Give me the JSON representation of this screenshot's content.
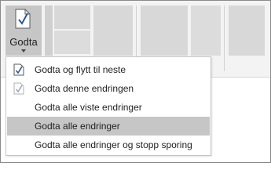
{
  "ribbon": {
    "accept_button": {
      "label": "Godta",
      "icon": "document-checkmark-icon"
    }
  },
  "menu": {
    "items": [
      {
        "label": "Godta og flytt til neste",
        "icon": "document-check-icon",
        "highlighted": false
      },
      {
        "label": "Godta denne endringen",
        "icon": "document-check-faded-icon",
        "highlighted": false
      },
      {
        "label": "Godta alle viste endringer",
        "icon": "",
        "highlighted": false
      },
      {
        "label": "Godta alle endringer",
        "icon": "",
        "highlighted": true
      },
      {
        "label": "Godta alle endringer og stopp sporing",
        "icon": "",
        "highlighted": false
      }
    ]
  },
  "colors": {
    "ribbon_bg": "#f3f3f3",
    "selected": "#c6c6c6",
    "ghost": "#d8d8d8",
    "check_accent": "#2b579a"
  }
}
